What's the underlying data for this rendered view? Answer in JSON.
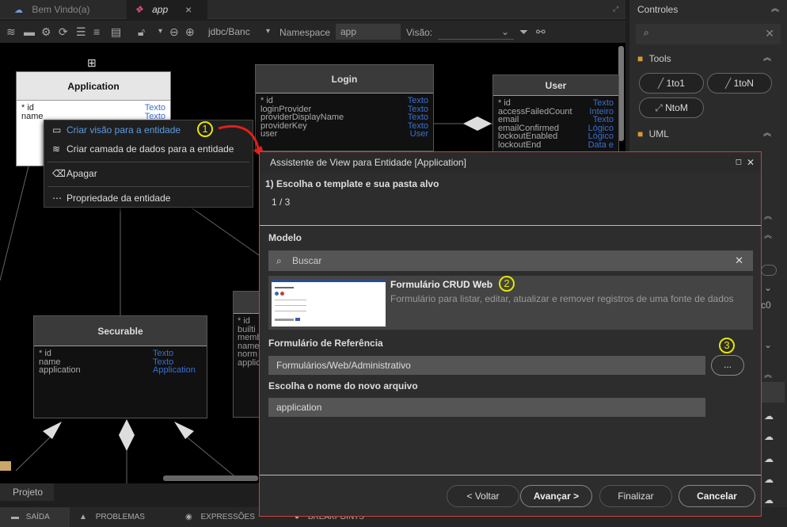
{
  "tabs": [
    {
      "label": "Bem Vindo(a)"
    },
    {
      "label": "app",
      "close": "×"
    }
  ],
  "toolbar": {
    "datasource": "jdbc/Banc",
    "namespace_label": "Namespace",
    "namespace_value": "app",
    "visao_label": "Visão:"
  },
  "entities": {
    "application": {
      "title": "Application",
      "rows": [
        {
          "name": "* id",
          "type": "Texto"
        },
        {
          "name": "name",
          "type": "Texto"
        }
      ]
    },
    "login": {
      "title": "Login",
      "rows": [
        {
          "name": "* id",
          "type": "Texto"
        },
        {
          "name": "loginProvider",
          "type": "Texto"
        },
        {
          "name": "providerDisplayName",
          "type": "Texto"
        },
        {
          "name": "providerKey",
          "type": "Texto"
        },
        {
          "name": "user",
          "type": "User"
        }
      ]
    },
    "user": {
      "title": "User",
      "rows": [
        {
          "name": "* id",
          "type": "Texto"
        },
        {
          "name": "accessFailedCount",
          "type": "Inteiro"
        },
        {
          "name": "email",
          "type": "Texto"
        },
        {
          "name": "emailConfirmed",
          "type": "Lógico"
        },
        {
          "name": "lockoutEnabled",
          "type": "Lógico"
        },
        {
          "name": "lockoutEnd",
          "type": "Data e"
        }
      ]
    },
    "securable": {
      "title": "Securable",
      "rows": [
        {
          "name": "* id",
          "type": "Texto"
        },
        {
          "name": "name",
          "type": "Texto"
        },
        {
          "name": "application",
          "type": "Application"
        }
      ]
    },
    "role": {
      "rows": [
        {
          "name": "* id"
        },
        {
          "name": "builti"
        },
        {
          "name": "memb"
        },
        {
          "name": "name"
        },
        {
          "name": "norm"
        },
        {
          "name": "applic"
        }
      ]
    }
  },
  "context_menu": {
    "items": [
      {
        "label": "Criar visão para a entidade"
      },
      {
        "label": "Criar camada de dados para a entidade"
      },
      {
        "label": "Apagar"
      },
      {
        "label": "Propriedade da entidade"
      }
    ]
  },
  "badges": [
    "1",
    "2",
    "3"
  ],
  "dialog": {
    "title": "Assistente de View para Entidade [Application]",
    "step_title": "1) Escolha o template e sua pasta alvo",
    "step_counter": "1 / 3",
    "modelo_label": "Modelo",
    "search_placeholder": "Buscar",
    "template_name": "Formulário CRUD Web",
    "template_desc": "Formulário para listar, editar, atualizar e remover registros de uma fonte de dados",
    "ref_label": "Formulário de Referência",
    "ref_value": "Formulários/Web/Administrativo",
    "browse_label": "...",
    "file_label": "Escolha o nome do novo arquivo",
    "file_value": "application",
    "buttons": {
      "back": "< Voltar",
      "next": "Avançar >",
      "finish": "Finalizar",
      "cancel": "Cancelar"
    }
  },
  "right_panel": {
    "header": "Controles",
    "tools_label": "Tools",
    "uml_label": "UML",
    "tools": [
      "1to1",
      "1toN",
      "NtoM"
    ],
    "partial_text": "c0"
  },
  "bottom": {
    "project_tab": "Projeto",
    "tabs": [
      "SAÍDA",
      "PROBLEMAS",
      "EXPRESSÕES",
      "BREAKPOINTS"
    ]
  },
  "colors": {
    "accent_red": "#c8413c",
    "badge_yellow": "#e6e600",
    "link_blue": "#3b6fd0"
  }
}
